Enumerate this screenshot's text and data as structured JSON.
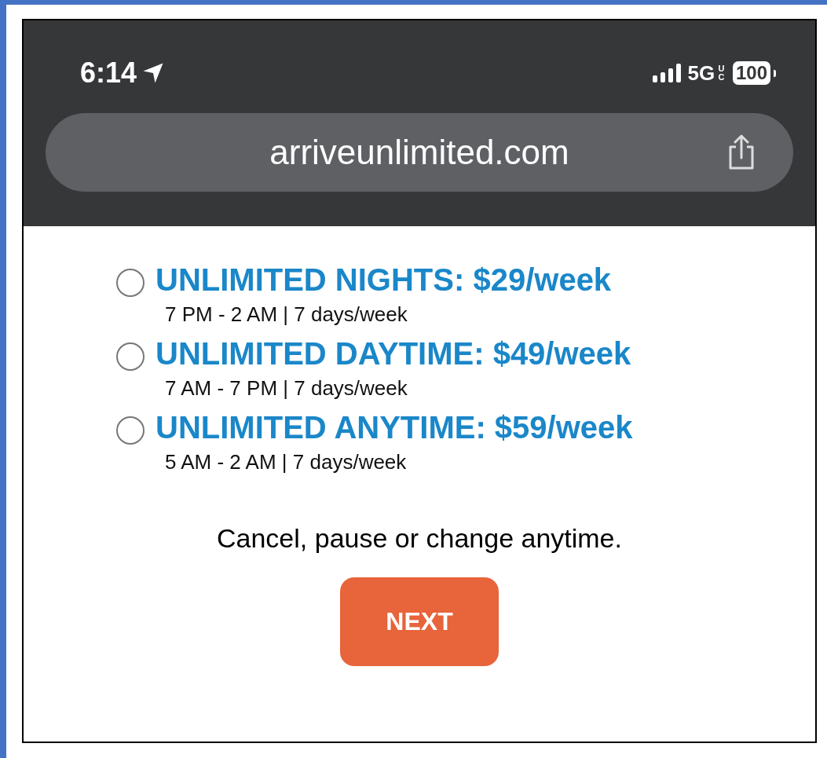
{
  "status_bar": {
    "time": "6:14",
    "network": "5G",
    "network_suffix": "UC",
    "battery": "100"
  },
  "address_bar": {
    "url": "arriveunlimited.com"
  },
  "plans": [
    {
      "title": "UNLIMITED NIGHTS: $29/week",
      "hours": "7 PM - 2 AM | 7 days/week",
      "selected": false
    },
    {
      "title": "UNLIMITED DAYTIME: $49/week",
      "hours": "7 AM - 7 PM | 7 days/week",
      "selected": false
    },
    {
      "title": "UNLIMITED ANYTIME: $59/week",
      "hours": "5 AM - 2 AM | 7 days/week",
      "selected": false
    }
  ],
  "note": "Cancel, pause or change anytime.",
  "next_button": {
    "label": "NEXT"
  }
}
